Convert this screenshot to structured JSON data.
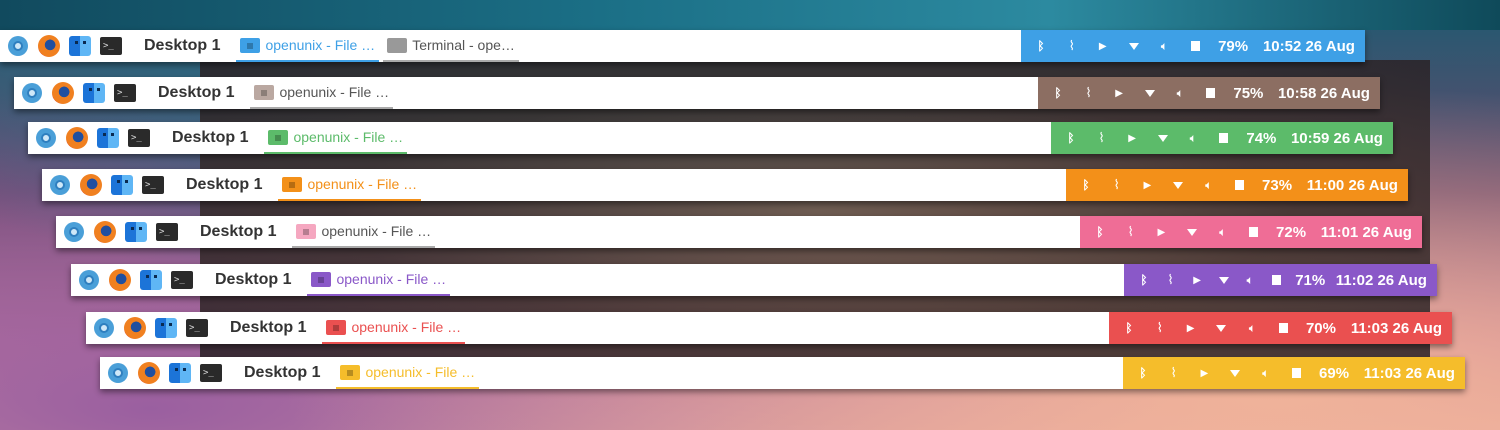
{
  "panels": [
    {
      "desktop": "Desktop 1",
      "accent": "#3ea0e6",
      "tasks": [
        {
          "label": "openunix - File …",
          "type": "folder",
          "active": true
        },
        {
          "label": "Terminal - ope…",
          "type": "terminal",
          "active": false
        }
      ],
      "battery": "79%",
      "clock": "10:52 26 Aug"
    },
    {
      "desktop": "Desktop 1",
      "accent": "#8c6e62",
      "tasks": [
        {
          "label": "openunix - File …",
          "type": "folder",
          "active": false
        }
      ],
      "battery": "75%",
      "clock": "10:58 26 Aug"
    },
    {
      "desktop": "Desktop 1",
      "accent": "#5cbb6a",
      "tasks": [
        {
          "label": "openunix - File …",
          "type": "folder",
          "active": true
        }
      ],
      "battery": "74%",
      "clock": "10:59 26 Aug"
    },
    {
      "desktop": "Desktop 1",
      "accent": "#f39019",
      "tasks": [
        {
          "label": "openunix - File …",
          "type": "folder",
          "active": true
        }
      ],
      "battery": "73%",
      "clock": "11:00 26 Aug"
    },
    {
      "desktop": "Desktop 1",
      "accent": "#ef6d96",
      "tasks": [
        {
          "label": "openunix - File …",
          "type": "folder",
          "active": false
        }
      ],
      "battery": "72%",
      "clock": "11:01 26 Aug"
    },
    {
      "desktop": "Desktop 1",
      "accent": "#8a58c8",
      "tasks": [
        {
          "label": "openunix - File …",
          "type": "folder",
          "active": true
        }
      ],
      "battery": "71%",
      "clock": "11:02 26 Aug"
    },
    {
      "desktop": "Desktop 1",
      "accent": "#ea5050",
      "tasks": [
        {
          "label": "openunix - File …",
          "type": "folder",
          "active": true
        }
      ],
      "battery": "70%",
      "clock": "11:03 26 Aug"
    },
    {
      "desktop": "Desktop 1",
      "accent": "#f5bd2b",
      "tasks": [
        {
          "label": "openunix - File …",
          "type": "folder",
          "active": true
        }
      ],
      "battery": "69%",
      "clock": "11:03 26 Aug"
    }
  ],
  "launchers": [
    "chromium-icon",
    "firefox-icon",
    "file-manager-icon",
    "terminal-icon"
  ],
  "tray_icons": [
    "bluetooth-icon",
    "paperclip-icon",
    "terminal-tray-icon",
    "wifi-icon",
    "volume-icon",
    "battery-icon"
  ]
}
